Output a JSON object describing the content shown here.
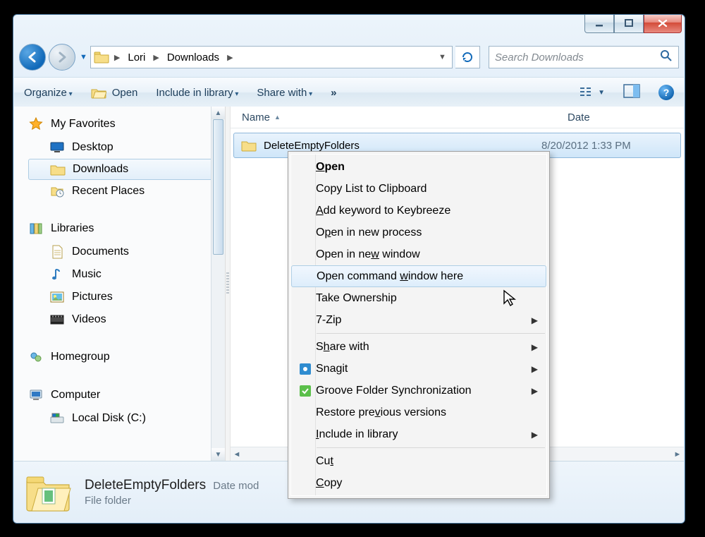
{
  "breadcrumb": {
    "root_icon": "folder",
    "items": [
      "Lori",
      "Downloads"
    ]
  },
  "search": {
    "placeholder": "Search Downloads"
  },
  "toolbar": {
    "organize": "Organize",
    "open": "Open",
    "include": "Include in library",
    "share": "Share with",
    "more": "»"
  },
  "sidebar": {
    "favorites": {
      "header": "My Favorites",
      "items": [
        "Desktop",
        "Downloads",
        "Recent Places"
      ],
      "selected_index": 1
    },
    "libraries": {
      "header": "Libraries",
      "items": [
        "Documents",
        "Music",
        "Pictures",
        "Videos"
      ]
    },
    "homegroup": {
      "header": "Homegroup"
    },
    "computer": {
      "header": "Computer",
      "items": [
        "Local Disk (C:)"
      ]
    }
  },
  "columns": {
    "name": "Name",
    "date": "Date"
  },
  "files": [
    {
      "name": "DeleteEmptyFolders",
      "date": "8/20/2012 1:33 PM",
      "selected": true
    }
  ],
  "details": {
    "name": "DeleteEmptyFolders",
    "type": "File folder",
    "date_label": "Date mod"
  },
  "context_menu": {
    "highlighted_index": 4,
    "sections": [
      [
        "Open",
        "Copy List to Clipboard",
        "Add keyword to Keybreeze",
        "Open in new process",
        "Open in new window",
        "Open command window here",
        "Take Ownership",
        "7-Zip"
      ],
      [
        "Share with",
        "Snagit",
        "Groove Folder Synchronization",
        "Restore previous versions",
        "Include in library"
      ],
      [
        "Cut",
        "Copy"
      ]
    ],
    "submenu_flags": {
      "7-Zip": true,
      "Share with": true,
      "Snagit": true,
      "Groove Folder Synchronization": true,
      "Include in library": true
    },
    "bold_flags": {
      "Open": true
    },
    "icons": {
      "Snagit": "snagit",
      "Groove Folder Synchronization": "groove"
    },
    "underline": {
      "Open": "O",
      "Add keyword to Keybreeze": "A",
      "Open in new process": "p",
      "Open in new window": "w",
      "Open command window here": "w",
      "Share with": "h",
      "Restore previous versions": "v",
      "Include in library": "I",
      "Cut": "t",
      "Copy": "C"
    }
  }
}
